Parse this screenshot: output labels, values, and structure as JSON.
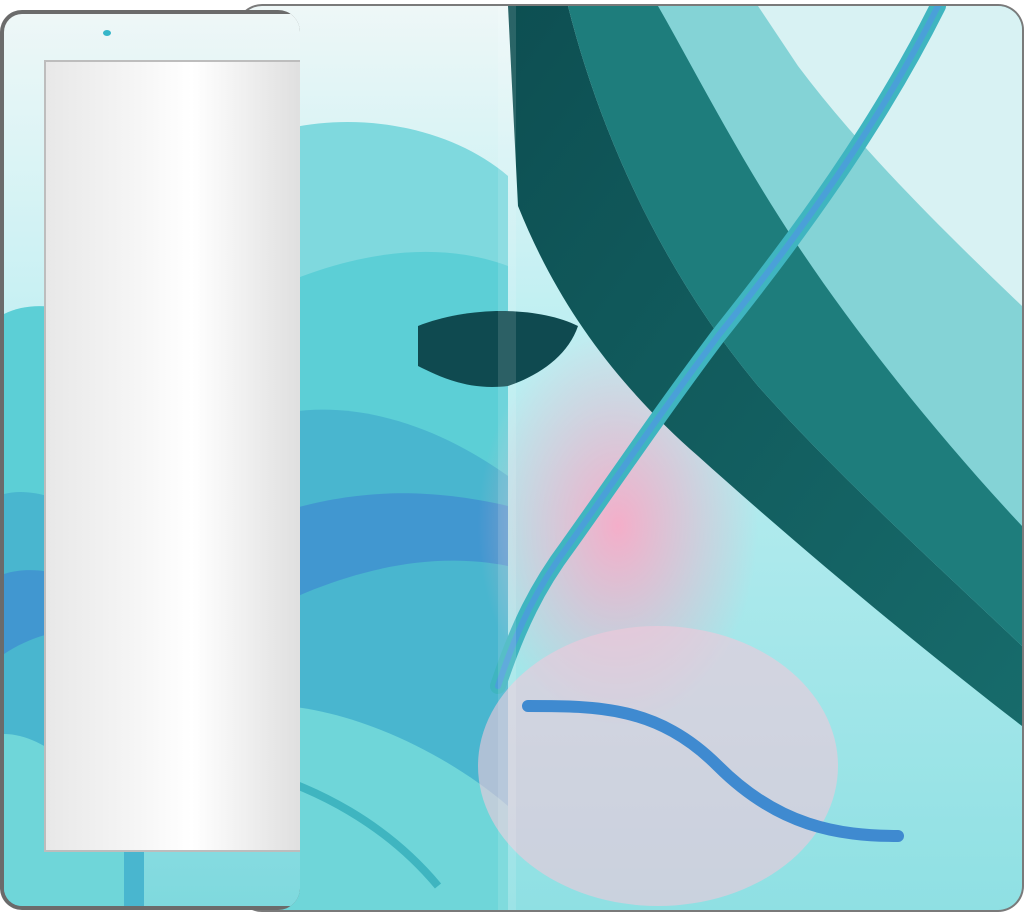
{
  "colors": {
    "frame": "#6b6b6b",
    "cyan_light": "#bfeff2",
    "cyan": "#5ccfd6",
    "teal": "#3fb5c0",
    "deep_teal": "#0f5a5c",
    "blue": "#3f8ad0",
    "pink": "#f2b8cf",
    "white_wash": "#eef7f7"
  },
  "icons": {
    "camera": "camera-dot-icon"
  }
}
